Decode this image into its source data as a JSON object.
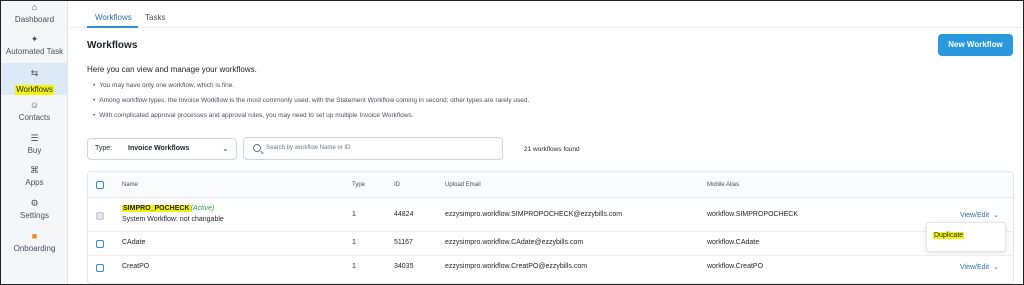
{
  "sidebar": {
    "items": [
      {
        "label": "Dashboard",
        "icon": "home-icon",
        "glyph": "⌂"
      },
      {
        "label": "Automated Task",
        "icon": "sparkle-icon",
        "glyph": "✦"
      },
      {
        "label": "Workflows",
        "icon": "workflow-icon",
        "glyph": "⇆"
      },
      {
        "label": "Contacts",
        "icon": "contacts-icon",
        "glyph": "☺"
      },
      {
        "label": "Buy",
        "icon": "cart-icon",
        "glyph": "☰"
      },
      {
        "label": "Apps",
        "icon": "apps-icon",
        "glyph": "⌘"
      },
      {
        "label": "Settings",
        "icon": "gear-icon",
        "glyph": "⚙"
      },
      {
        "label": "Onboarding",
        "icon": "video-icon",
        "glyph": "■"
      }
    ],
    "active_index": 2
  },
  "tabs": [
    {
      "label": "Workflows",
      "active": true
    },
    {
      "label": "Tasks",
      "active": false
    }
  ],
  "header": {
    "title": "Workflows",
    "new_button": "New Workflow"
  },
  "intro": {
    "heading": "Here you can view and manage your workflows.",
    "bullets": [
      "You may have only one workflow, which is fine.",
      "Among workflow types, the Invoice Workflow is the most commonly used, with the Statement Workflow coming in second; other types are rarely used.",
      "With complicated approval processes and approval rules, you may need to set up multiple Invoice Workflows."
    ]
  },
  "filters": {
    "type_label": "Type:",
    "type_value": "Invoice Workflows",
    "search_placeholder": "Search by workflow Name or ID",
    "count_text": "21 workflows found"
  },
  "table": {
    "columns": [
      "Name",
      "Type",
      "ID",
      "Upload Email",
      "Mobile Alias"
    ],
    "rows": [
      {
        "name": "SIMPRO_POCHECK",
        "status": "(Active)",
        "subtitle": "System Workflow: not changable",
        "type": "1",
        "id": "44824",
        "email": "ezzysimpro.workflow.SIMPROPOCHECK@ezzybills.com",
        "alias": "workflow.SIMPROPOCHECK",
        "action": "View/Edit"
      },
      {
        "name": "CAdate",
        "status": "",
        "subtitle": "",
        "type": "1",
        "id": "51167",
        "email": "ezzysimpro.workflow.CAdate@ezzybills.com",
        "alias": "workflow.CAdate",
        "action": ""
      },
      {
        "name": "CreatPO",
        "status": "",
        "subtitle": "",
        "type": "1",
        "id": "34035",
        "email": "ezzysimpro.workflow.CreatPO@ezzybills.com",
        "alias": "workflow.CreatPO",
        "action": "View/Edit"
      }
    ]
  },
  "dropdown": {
    "items": [
      "Duplicate"
    ]
  },
  "colors": {
    "accent": "#2a98de",
    "highlight": "#f4f40a",
    "active_status": "#2e9e44",
    "sidebar_bg": "#f4f6f8"
  }
}
